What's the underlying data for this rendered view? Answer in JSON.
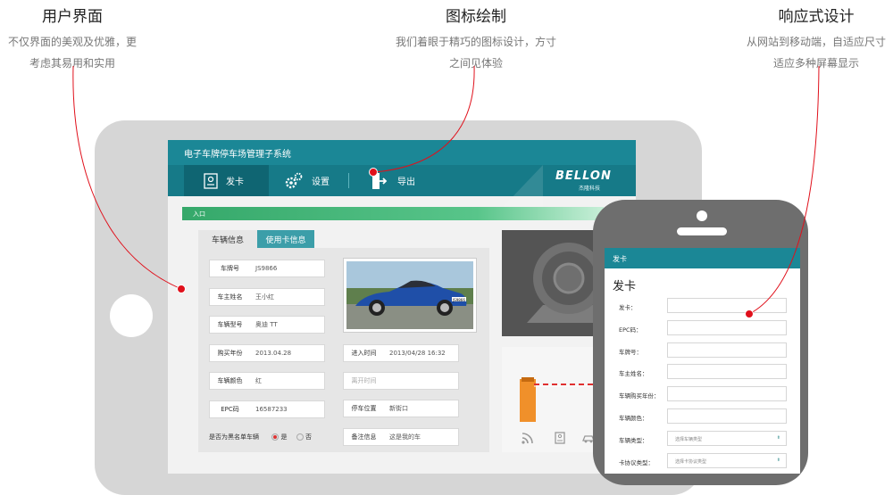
{
  "features": [
    {
      "title": "用户界面",
      "desc_lines": [
        "不仅界面的美观及优雅，更",
        "考虑其易用和实用"
      ]
    },
    {
      "title": "图标绘制",
      "desc_lines": [
        "我们着眼于精巧的图标设计，方寸",
        "之间见体验"
      ]
    },
    {
      "title": "响应式设计",
      "desc_lines": [
        "从网站到移动端，自适应尺寸",
        "适应多种屏幕显示"
      ]
    }
  ],
  "app": {
    "title": "电子车牌停车场管理子系统",
    "toolbar": [
      {
        "label": "发卡",
        "icon": "card-icon",
        "active": true
      },
      {
        "label": "设置",
        "icon": "gear-icon",
        "active": false
      },
      {
        "label": "导出",
        "icon": "export-icon",
        "active": false
      }
    ],
    "brand": "BELLON",
    "brand_sub": "杰隆科技",
    "entrance_label": "入口",
    "tabs": [
      "车辆信息",
      "使用卡信息"
    ],
    "fields_left": [
      {
        "label": "车牌号",
        "value": "JS9866"
      },
      {
        "label": "车主姓名",
        "value": "王小红"
      },
      {
        "label": "车辆型号",
        "value": "奥迪 TT"
      },
      {
        "label": "购买年份",
        "value": "2013.04.28"
      },
      {
        "label": "车辆颜色",
        "value": "红"
      },
      {
        "label": "EPC码",
        "value": "16587233"
      }
    ],
    "fields_right": [
      {
        "label": "进入时间",
        "value": "2013/04/28  16:32"
      },
      {
        "label": "离开时间",
        "value": ""
      },
      {
        "label": "停车位置",
        "value": "新街口"
      },
      {
        "label": "备注信息",
        "value": "这是我的车"
      }
    ],
    "blacklist": {
      "label": "是否为黑名单车辆",
      "yes": "是",
      "no": "否",
      "selected": "是"
    },
    "car_badge": "JS9866",
    "accent": "#1b8796"
  },
  "mobile": {
    "header": "发卡",
    "title": "发卡",
    "fields": [
      {
        "label": "发卡：",
        "type": "input",
        "value": ""
      },
      {
        "label": "EPC码：",
        "type": "input",
        "value": ""
      },
      {
        "label": "车牌号：",
        "type": "input",
        "value": ""
      },
      {
        "label": "车主姓名：",
        "type": "input",
        "value": ""
      },
      {
        "label": "车辆购买年份：",
        "type": "input",
        "value": ""
      },
      {
        "label": "车辆颜色：",
        "type": "input",
        "value": ""
      },
      {
        "label": "车辆类型：",
        "type": "select",
        "value": "选择车辆类型"
      },
      {
        "label": "卡协议类型：",
        "type": "select",
        "value": "选择卡协议类型"
      }
    ]
  },
  "colors": {
    "pointer": "#e0101b",
    "teal": "#1b8796",
    "green": "#35a86a"
  }
}
